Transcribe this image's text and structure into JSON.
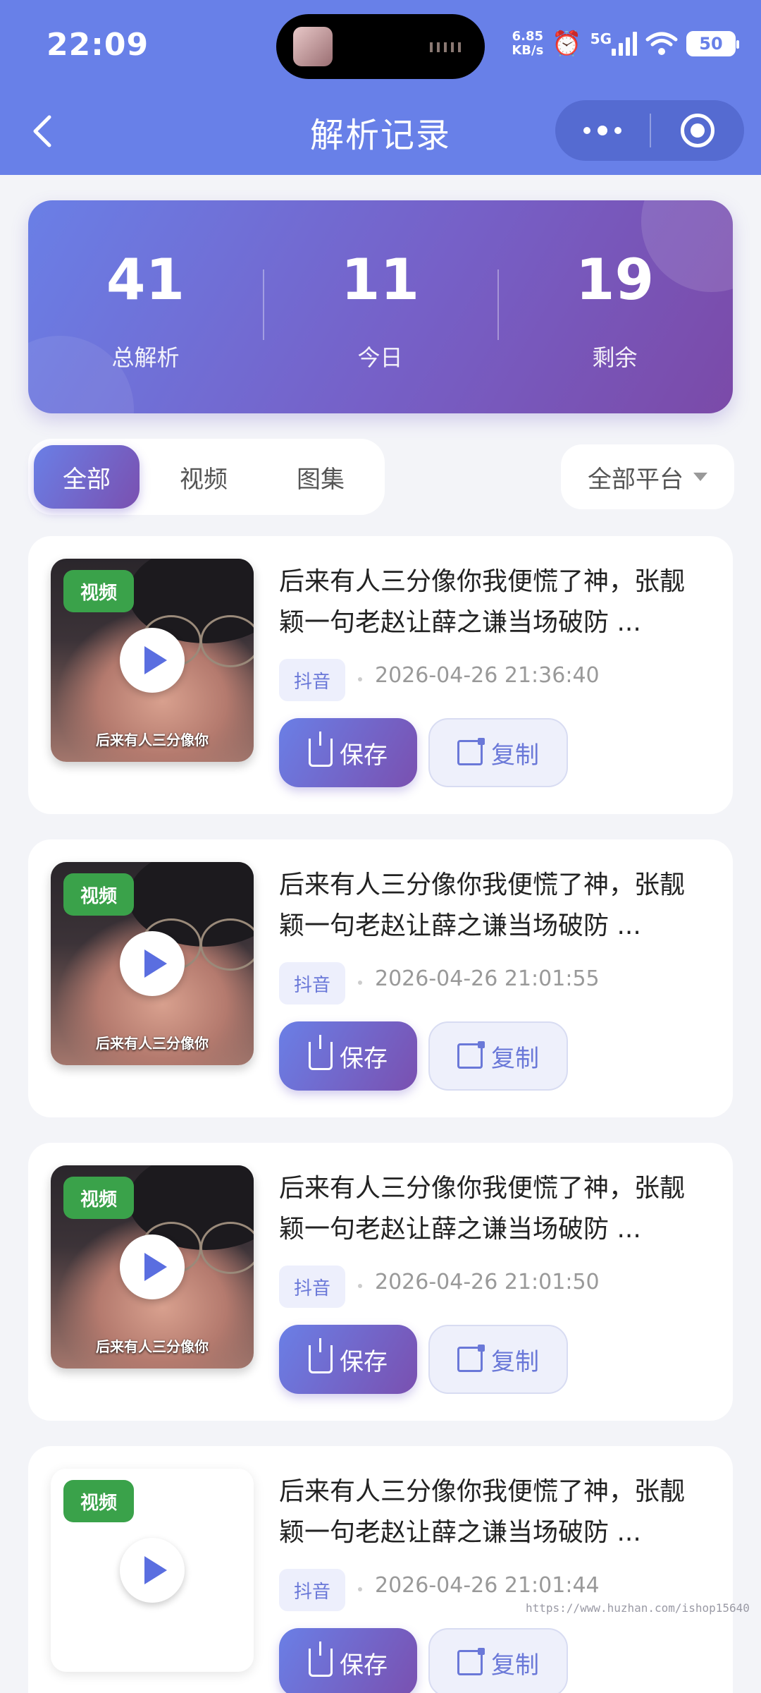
{
  "status_bar": {
    "time": "22:09",
    "net_speed_value": "6.85",
    "net_speed_unit": "KB/s",
    "network": "5G",
    "battery": "50",
    "icons": [
      "alarm-icon",
      "signal-icon",
      "wifi-icon",
      "battery-icon"
    ]
  },
  "nav": {
    "title": "解析记录",
    "back_icon": "chevron-left-icon",
    "more_icon": "more-dots-icon",
    "close_icon": "target-circle-icon"
  },
  "stats": [
    {
      "value": "41",
      "label": "总解析"
    },
    {
      "value": "11",
      "label": "今日"
    },
    {
      "value": "19",
      "label": "剩余"
    }
  ],
  "tabs": [
    {
      "label": "全部",
      "active": true
    },
    {
      "label": "视频",
      "active": false
    },
    {
      "label": "图集",
      "active": false
    }
  ],
  "platform_filter": {
    "label": "全部平台"
  },
  "records": [
    {
      "badge": "视频",
      "caption": "后来有人三分像你",
      "title": "后来有人三分像你我便慌了神，张靓颖一句老赵让薛之谦当场破防 ...",
      "platform": "抖音",
      "time": "2026-04-26 21:36:40",
      "save_label": "保存",
      "copy_label": "复制",
      "has_thumbnail": true
    },
    {
      "badge": "视频",
      "caption": "后来有人三分像你",
      "title": "后来有人三分像你我便慌了神，张靓颖一句老赵让薛之谦当场破防 ...",
      "platform": "抖音",
      "time": "2026-04-26 21:01:55",
      "save_label": "保存",
      "copy_label": "复制",
      "has_thumbnail": true
    },
    {
      "badge": "视频",
      "caption": "后来有人三分像你",
      "title": "后来有人三分像你我便慌了神，张靓颖一句老赵让薛之谦当场破防 ...",
      "platform": "抖音",
      "time": "2026-04-26 21:01:50",
      "save_label": "保存",
      "copy_label": "复制",
      "has_thumbnail": true
    },
    {
      "badge": "视频",
      "caption": "",
      "title": "后来有人三分像你我便慌了神，张靓颖一句老赵让薛之谦当场破防 ...",
      "platform": "抖音",
      "time": "2026-04-26 21:01:44",
      "save_label": "保存",
      "copy_label": "复制",
      "has_thumbnail": false
    }
  ],
  "watermark": "https://www.huzhan.com/ishop15640",
  "colors": {
    "header": "#6880e8",
    "accent_start": "#6a7fe6",
    "accent_end": "#7a50b0",
    "badge_green": "#3aa24a",
    "tag_text": "#6a78d8"
  }
}
